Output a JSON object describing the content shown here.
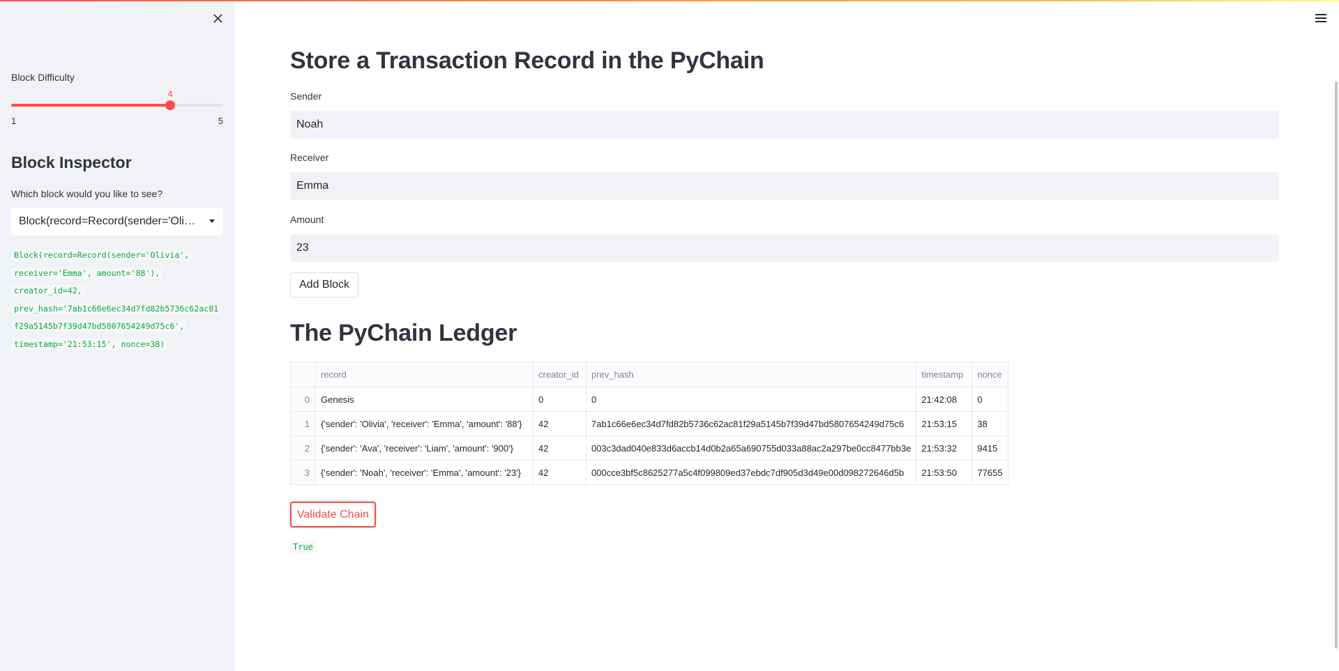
{
  "sidebar": {
    "close_icon": "close-icon",
    "slider": {
      "label": "Block Difficulty",
      "value": "4",
      "min": "1",
      "max": "5",
      "accent_color": "#ff4b4b"
    },
    "inspector": {
      "title": "Block Inspector",
      "question": "Which block would you like to see?",
      "selected": "Block(record=Record(sender='Olivia', receiver='Emma', amount='88'), creator_id=42, prev_hash='7ab1c66e6ec34d7fd82b5736c62ac81f29a5145b7f39d47bd5807654249d75c6', timestamp='21:53:15', nonce=38)",
      "code_lines": [
        "Block(record=Record(sender='Olivia',",
        "receiver='Emma', amount='88'),",
        "creator_id=42,",
        "prev_hash='7ab1c66e6ec34d7fd82b5736c62ac81",
        "f29a5145b7f39d47bd5807654249d75c6',",
        "timestamp='21:53:15', nonce=38)"
      ]
    }
  },
  "header": {
    "menu_icon": "hamburger-menu-icon"
  },
  "main": {
    "title": "Store a Transaction Record in the PyChain",
    "fields": {
      "sender_label": "Sender",
      "sender_value": "Noah",
      "receiver_label": "Receiver",
      "receiver_value": "Emma",
      "amount_label": "Amount",
      "amount_value": "23"
    },
    "add_button": "Add Block",
    "ledger_title": "The PyChain Ledger",
    "table": {
      "columns": [
        "",
        "record",
        "creator_id",
        "prev_hash",
        "timestamp",
        "nonce"
      ],
      "rows": [
        [
          "0",
          "Genesis",
          "0",
          "0",
          "21:42:08",
          "0"
        ],
        [
          "1",
          "{'sender': 'Olivia', 'receiver': 'Emma', 'amount': '88'}",
          "42",
          "7ab1c66e6ec34d7fd82b5736c62ac81f29a5145b7f39d47bd5807654249d75c6",
          "21:53:15",
          "38"
        ],
        [
          "2",
          "{'sender': 'Ava', 'receiver': 'Liam', 'amount': '900'}",
          "42",
          "003c3dad040e833d6accb14d0b2a65a690755d033a88ac2a297be0cc8477bb3e",
          "21:53:32",
          "9415"
        ],
        [
          "3",
          "{'sender': 'Noah', 'receiver': 'Emma', 'amount': '23'}",
          "42",
          "000cce3bf5c8625277a5c4f099809ed37ebdc7df905d3d49e00d098272646d5b",
          "21:53:50",
          "77655"
        ]
      ]
    },
    "validate_button": "Validate Chain",
    "validation_result": "True"
  }
}
